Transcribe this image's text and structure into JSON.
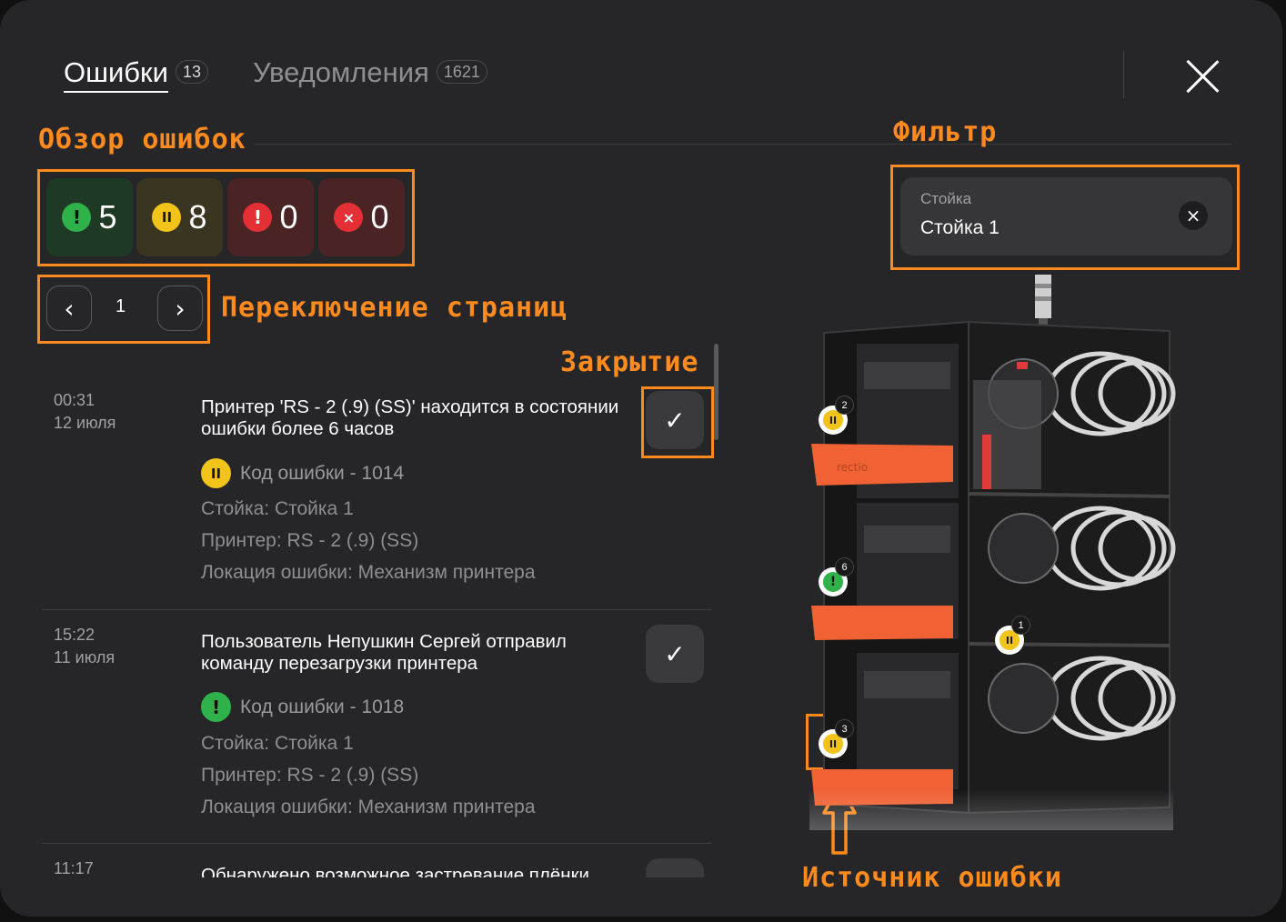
{
  "tabs": [
    {
      "label": "Ошибки",
      "count": "13",
      "active": true
    },
    {
      "label": "Уведомления",
      "count": "1621",
      "active": false
    }
  ],
  "annotations": {
    "overview": "Обзор ошибок",
    "filter": "Фильтр",
    "pagination": "Переключение страниц",
    "close": "Закрытие",
    "source": "Источник ошибки"
  },
  "stats": [
    {
      "type": "green",
      "icon": "!",
      "value": "5"
    },
    {
      "type": "yellow",
      "icon": "II",
      "value": "8"
    },
    {
      "type": "red",
      "icon": "!",
      "value": "0"
    },
    {
      "type": "red-x",
      "icon": "×",
      "value": "0"
    }
  ],
  "colors": {
    "accent_annotation": "#ff8a1e",
    "green": "#2fb24a",
    "yellow": "#f2c319",
    "red": "#e42f35"
  },
  "pagination": {
    "prev": "‹",
    "page": "1",
    "next": "›"
  },
  "errors": [
    {
      "time": "00:31",
      "date": "12 июля",
      "title": "Принтер 'RS - 2 (.9) (SS)' находится в состоянии ошибки более 6 часов",
      "code_icon": "II",
      "code": "Код ошибки - 1014",
      "rack": "Стойка: Стойка 1",
      "printer": "Принтер: RS - 2 (.9) (SS)",
      "location": "Локация ошибки: Механизм принтера"
    },
    {
      "time": "15:22",
      "date": "11 июля",
      "title": "Пользователь Непушкин Сергей отправил команду перезагрузки принтера",
      "code_icon": "!",
      "code": "Код ошибки - 1018",
      "rack": "Стойка: Стойка 1",
      "printer": "Принтер: RS - 2 (.9) (SS)",
      "location": "Локация ошибки: Механизм принтера"
    },
    {
      "time": "11:17",
      "title": "Обнаружено возможное застревание плёнки"
    }
  ],
  "check_icon": "✓",
  "filter": {
    "label": "Стойка",
    "value": "Стойка 1",
    "clear_icon": "×"
  },
  "rack_markers": [
    {
      "type": "yellow",
      "icon": "II",
      "count": "2"
    },
    {
      "type": "green",
      "icon": "!",
      "count": "6"
    },
    {
      "type": "yellow",
      "icon": "II",
      "count": "1"
    },
    {
      "type": "yellow",
      "icon": "II",
      "count": "3"
    }
  ],
  "rack_brand": "rectio"
}
